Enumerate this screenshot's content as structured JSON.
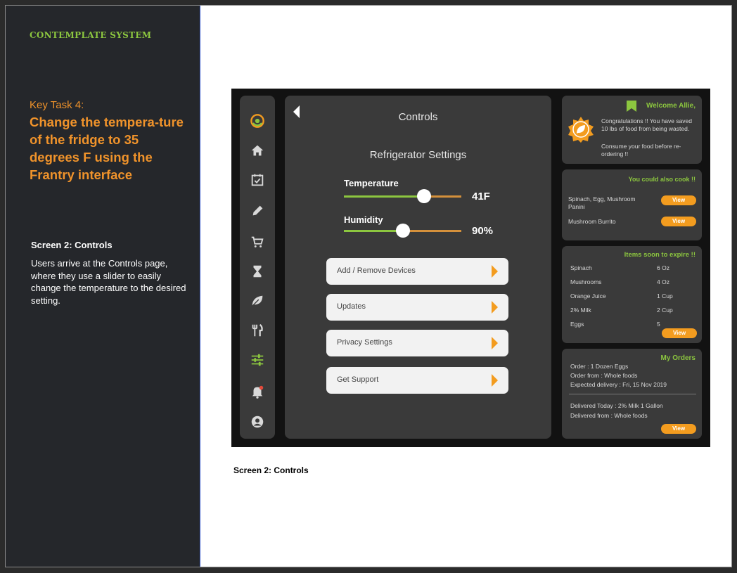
{
  "left_panel": {
    "brand": "CONTEMPLATE SYSTEM",
    "task_label": "Key Task 4:",
    "task_title": "Change the tempera-ture of the fridge to 35 degrees F using the Frantry interface",
    "screen_heading": "Screen 2: Controls",
    "screen_desc": "Users arrive at the Controls page, where they use a slider to easily change the temperature to the desired setting."
  },
  "sidebar": {
    "icons": [
      "app-logo-icon",
      "home-icon",
      "calendar-check-icon",
      "pencil-icon",
      "cart-icon",
      "hourglass-icon",
      "leaf-icon",
      "utensils-icon",
      "sliders-icon",
      "bell-icon",
      "user-icon"
    ],
    "active": "sliders-icon"
  },
  "controls": {
    "title": "Controls",
    "subtitle": "Refrigerator Settings",
    "temperature": {
      "label": "Temperature",
      "value": "41F",
      "level": 0.68
    },
    "humidity": {
      "label": "Humidity",
      "value": "90%",
      "level": 0.5
    },
    "menu": [
      "Add / Remove Devices",
      "Updates",
      "Privacy Settings",
      "Get Support"
    ]
  },
  "welcome": {
    "title": "Welcome Allie,",
    "line1": "Congratulations !! You have saved 10 lbs of food from being wasted.",
    "line2": "Consume your food before re-ordering !!"
  },
  "cook": {
    "title": "You could also cook !!",
    "items": [
      "Spinach, Egg, Mushroom Panini",
      "Mushroom Burrito"
    ],
    "button": "View"
  },
  "expire": {
    "title": "Items soon to expire !!",
    "items": [
      {
        "name": "Spinach",
        "qty": "6 Oz"
      },
      {
        "name": "Mushrooms",
        "qty": "4 Oz"
      },
      {
        "name": "Orange Juice",
        "qty": "1 Cup"
      },
      {
        "name": "2% Milk",
        "qty": "2 Cup"
      },
      {
        "name": "Eggs",
        "qty": "5"
      }
    ],
    "button": "View"
  },
  "orders": {
    "title": "My Orders",
    "order": "Order : 1 Dozen Eggs",
    "order_from": "Order from : Whole foods",
    "expected": "Expected delivery : Fri, 15 Nov 2019",
    "delivered": "Delivered Today : 2% Milk 1 Gallon",
    "delivered_from": "Delivered from : Whole foods",
    "button": "View"
  },
  "caption": "Screen 2: Controls",
  "colors": {
    "accent_orange": "#f0932b",
    "accent_green": "#8cc63f",
    "panel": "#25272b",
    "card": "#3a3a3a"
  }
}
